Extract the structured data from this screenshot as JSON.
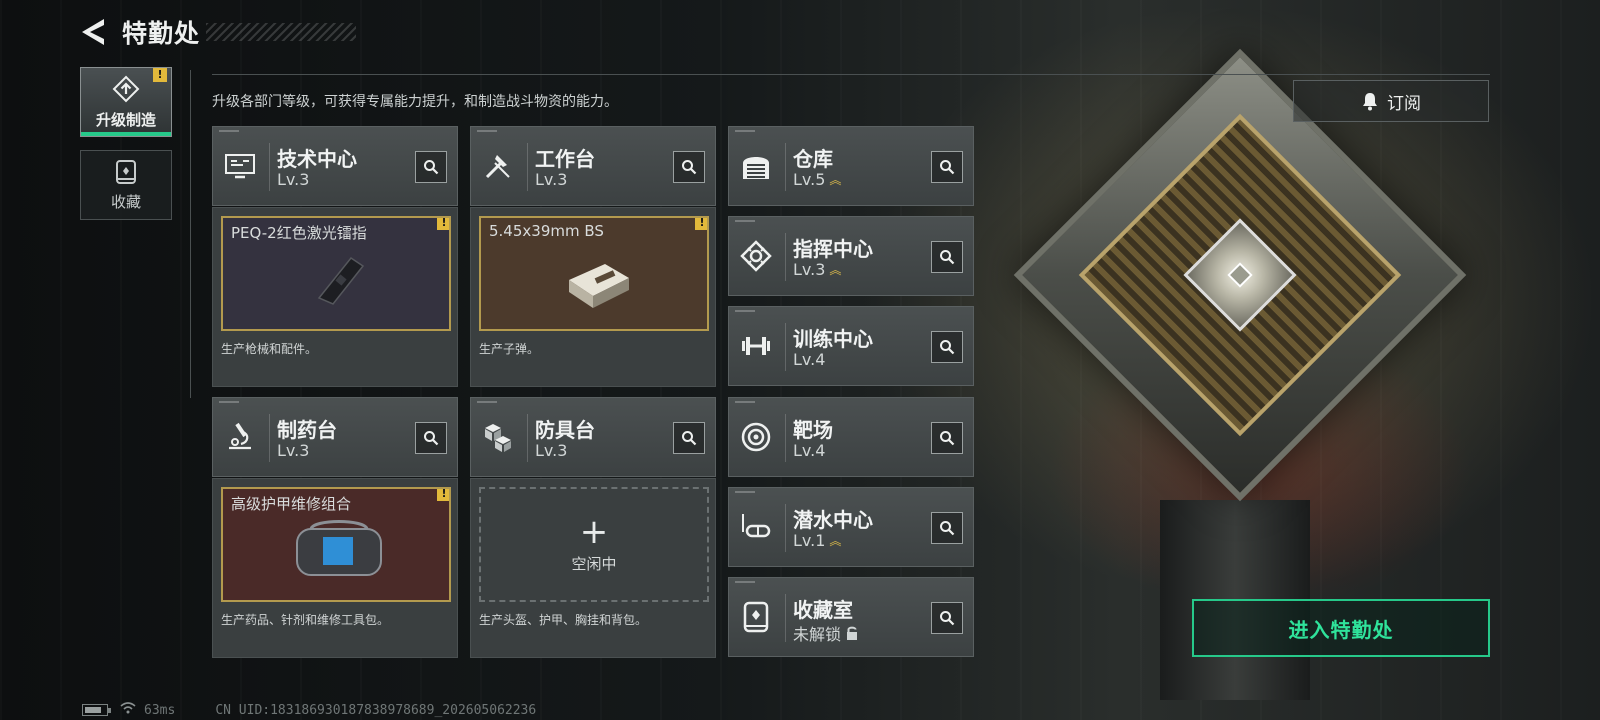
{
  "header": {
    "title": "特勤处"
  },
  "nav": {
    "items": [
      {
        "label": "升级制造",
        "active": true,
        "badge": "!"
      },
      {
        "label": "收藏",
        "active": false
      }
    ]
  },
  "description": "升级各部门等级，可获得专属能力提升，和制造战斗物资的能力。",
  "subscribe": {
    "label": "订阅",
    "icon": "bell-icon"
  },
  "enter_button": {
    "label": "进入特勤处"
  },
  "large_cards": [
    {
      "name": "技术中心",
      "level": "Lv.3",
      "icon": "monitor-icon",
      "product": "PEQ-2红色激光镭指",
      "product_bg": "#34323f",
      "badge": "!",
      "desc": "生产枪械和配件。"
    },
    {
      "name": "工作台",
      "level": "Lv.3",
      "icon": "tools-icon",
      "product": "5.45x39mm BS",
      "product_bg": "#4c3a2c",
      "badge": "!",
      "desc": "生产子弹。"
    },
    {
      "name": "制药台",
      "level": "Lv.3",
      "icon": "microscope-icon",
      "product": "高级护甲维修组合",
      "product_bg": "#4a2a28",
      "badge": "!",
      "desc": "生产药品、针剂和维修工具包。"
    },
    {
      "name": "防具台",
      "level": "Lv.3",
      "icon": "armor-blocks-icon",
      "idle_label": "空闲中",
      "desc": "生产头盔、护甲、胸挂和背包。"
    }
  ],
  "small_cards": [
    {
      "name": "仓库",
      "level": "Lv.5",
      "upgrade": true,
      "icon": "warehouse-icon"
    },
    {
      "name": "指挥中心",
      "level": "Lv.3",
      "upgrade": true,
      "icon": "chip-icon"
    },
    {
      "name": "训练中心",
      "level": "Lv.4",
      "upgrade": false,
      "icon": "dumbbell-icon"
    },
    {
      "name": "靶场",
      "level": "Lv.4",
      "upgrade": false,
      "icon": "target-icon"
    },
    {
      "name": "潜水中心",
      "level": "Lv.1",
      "upgrade": true,
      "icon": "diving-mask-icon"
    },
    {
      "name": "收藏室",
      "level": "未解锁",
      "upgrade": false,
      "locked": true,
      "icon": "collection-icon"
    }
  ],
  "status": {
    "ping": "63ms",
    "uid": "CN UID:1831869301878389786​89_202605062236"
  },
  "colors": {
    "accent": "#26c98a",
    "badge": "#e2b93b",
    "upgrade": "#d8b84b"
  }
}
